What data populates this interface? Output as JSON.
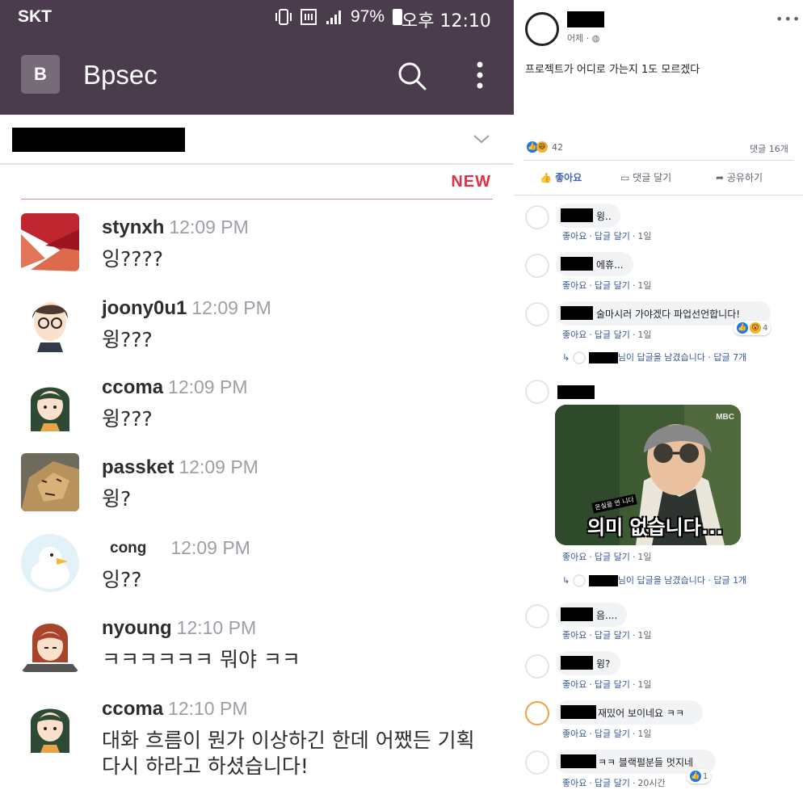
{
  "slack": {
    "status": {
      "carrier": "SKT",
      "battery": "97%",
      "clock": "오후 12:10"
    },
    "app": {
      "team_initial": "B",
      "team_name": "Bpsec"
    },
    "new_label": "NEW",
    "messages": [
      {
        "user": "stynxh",
        "time": "12:09 PM",
        "text": "잉????"
      },
      {
        "user": "joony0u1",
        "time": "12:09 PM",
        "text": "윙???"
      },
      {
        "user": "ccoma",
        "time": "12:09 PM",
        "text": "윙???"
      },
      {
        "user": "passket",
        "time": "12:09 PM",
        "text": "윙?"
      },
      {
        "user": "cong",
        "time": "12:09 PM",
        "text": "잉??"
      },
      {
        "user": "nyoung",
        "time": "12:10 PM",
        "text": "ㅋㅋㅋㅋㅋㅋ 뭐야 ㅋㅋ"
      },
      {
        "user": "ccoma",
        "time": "12:10 PM",
        "text": "대화 흐름이 뭔가 이상하긴 한데 어쨌든 기획",
        "text2": "다시 하라고 하셨습니다!"
      }
    ]
  },
  "fb": {
    "post_time": "어제 ·",
    "post_text": "프로젝트가 어디로 가는지 1도 모르겠다",
    "reaction_count": "42",
    "comment_count": "댓글 16개",
    "buttons": {
      "like": "좋아요",
      "comment": "댓글 달기",
      "share": "공유하기"
    },
    "comments": [
      {
        "text": "윙..",
        "like": "좋아요",
        "reply": "답글 달기",
        "age": "1일"
      },
      {
        "text": "에휴...",
        "like": "좋아요",
        "reply": "답글 달기",
        "age": "1일"
      },
      {
        "text": "술마시러 가야겠다 파업선언합니다!",
        "like": "좋아요",
        "reply": "답글 달기",
        "age": "1일",
        "reactions": "4",
        "replies": "님이 답글을 남겼습니다 · 답글 7개"
      },
      {
        "image_caption": "의미 없습니다...",
        "image_small": "온실을 연 니다",
        "image_logo": "MBC",
        "like": "좋아요",
        "reply": "답글 달기",
        "age": "1일",
        "replies": "님이 답글을 남겼습니다 · 답글 1개"
      },
      {
        "text": "음....",
        "like": "좋아요",
        "reply": "답글 달기",
        "age": "1일"
      },
      {
        "text": "윙?",
        "like": "좋아요",
        "reply": "답글 달기",
        "age": "1일"
      },
      {
        "text": "재밌어 보이네요 ㅋㅋ",
        "like": "좋아요",
        "reply": "답글 달기",
        "age": "1일"
      },
      {
        "text": "ㅋㅋ 블랙펄분들 멋지네",
        "like": "좋아요",
        "reply": "답글 달기",
        "age": "20시간",
        "reactions": "1"
      }
    ]
  }
}
